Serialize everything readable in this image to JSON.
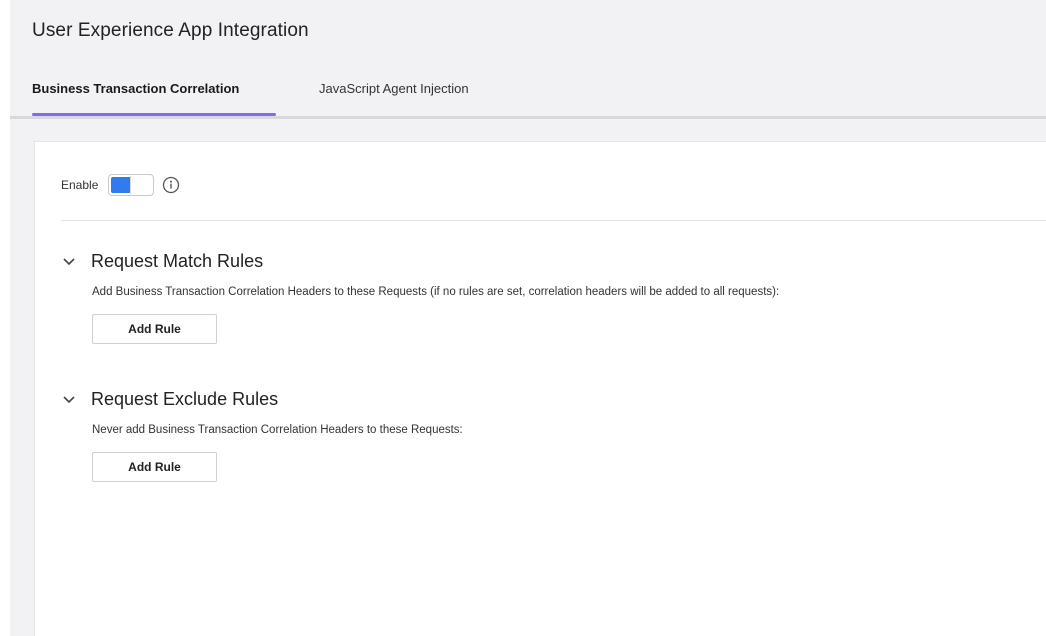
{
  "header": {
    "title": "User Experience App Integration"
  },
  "tabs": [
    {
      "label": "Business Transaction Correlation",
      "active": true
    },
    {
      "label": "JavaScript Agent Injection",
      "active": false
    }
  ],
  "enable": {
    "label": "Enable",
    "enabled": true
  },
  "sections": [
    {
      "title": "Request Match Rules",
      "description": "Add Business Transaction Correlation Headers to these Requests (if no rules are set, correlation headers will be added to all requests):",
      "button_label": "Add Rule"
    },
    {
      "title": "Request Exclude Rules",
      "description": "Never add Business Transaction Correlation Headers to these Requests:",
      "button_label": "Add Rule"
    }
  ],
  "colors": {
    "accent_tab": "#7b6cf0",
    "toggle_on": "#2f7bf0"
  },
  "icons": {
    "info": "info-circle-icon",
    "collapse": "chevron-down-icon"
  }
}
